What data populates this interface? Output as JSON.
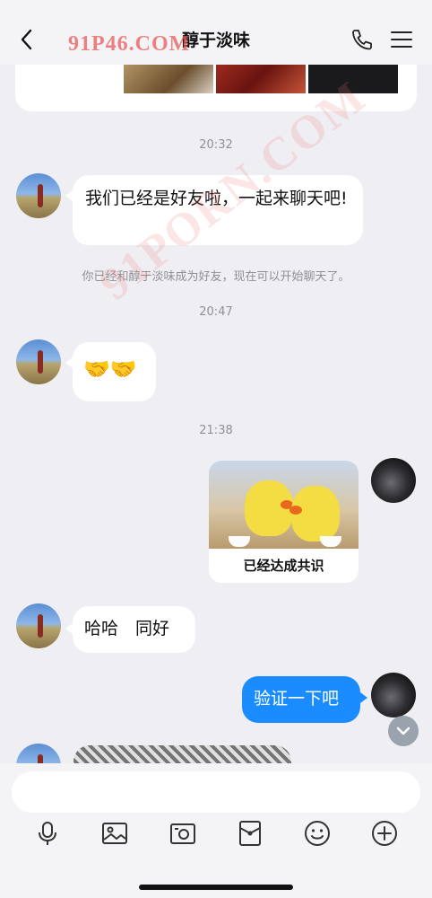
{
  "header": {
    "title": "醇于淡味",
    "watermark": "91P46.COM"
  },
  "watermark_diagonal": "91PORN.COM",
  "messages": {
    "time1": "20:32",
    "friend_msg1": "我们已经是好友啦，一起来聊天吧!",
    "system_notice": "你已经和醇于淡味成为好友，现在可以开始聊天了。",
    "time2": "20:47",
    "friend_emoji": "🤝🤝",
    "time3": "21:38",
    "my_sticker_caption": "已经达成共识",
    "friend_msg2": "哈哈　同好",
    "my_msg1": "验证一下吧"
  },
  "input": {
    "placeholder": ""
  },
  "toolbar": {
    "icons": [
      "microphone-icon",
      "image-icon",
      "camera-icon",
      "red-packet-icon",
      "emoji-icon",
      "plus-icon"
    ]
  },
  "colors": {
    "background": "#efeff3",
    "my_bubble": "#1a8cff",
    "friend_bubble": "#ffffff"
  }
}
